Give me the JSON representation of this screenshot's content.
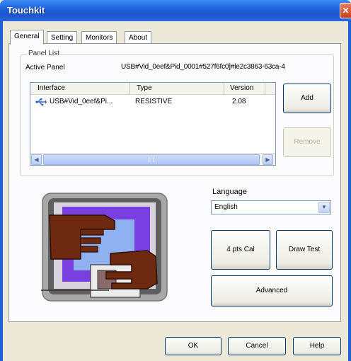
{
  "window": {
    "title": "Touchkit",
    "close_glyph": "✕"
  },
  "tabs": [
    "General",
    "Setting",
    "Monitors",
    "About"
  ],
  "panel_list": {
    "group_label": "Panel List",
    "active_panel_label": "Active Panel",
    "active_panel_value": "USB#Vid_0eef&Pid_0001#527f6fc0]#le2c3863-63ca-4",
    "columns": [
      "Interface",
      "Type",
      "Version"
    ],
    "rows": [
      {
        "interface": "USB#Vid_0eef&Pi...",
        "type": "RESISTIVE",
        "version": "2.08"
      }
    ],
    "add_label": "Add",
    "remove_label": "Remove"
  },
  "language": {
    "label": "Language",
    "selected": "English"
  },
  "buttons": {
    "cal_4pts": "4 pts Cal",
    "draw_test": "Draw Test",
    "advanced": "Advanced"
  },
  "footer": {
    "ok": "OK",
    "cancel": "Cancel",
    "help": "Help"
  },
  "colors": {
    "title_bar": "#1f5fd8",
    "dialog_bg": "#ece9d8",
    "illustration_purple": "#7a3fe0",
    "hand_brown": "#6e2a10"
  },
  "icons": [
    "usb-icon",
    "close-icon",
    "chevron-left-icon",
    "chevron-right-icon",
    "chevron-down-icon"
  ]
}
